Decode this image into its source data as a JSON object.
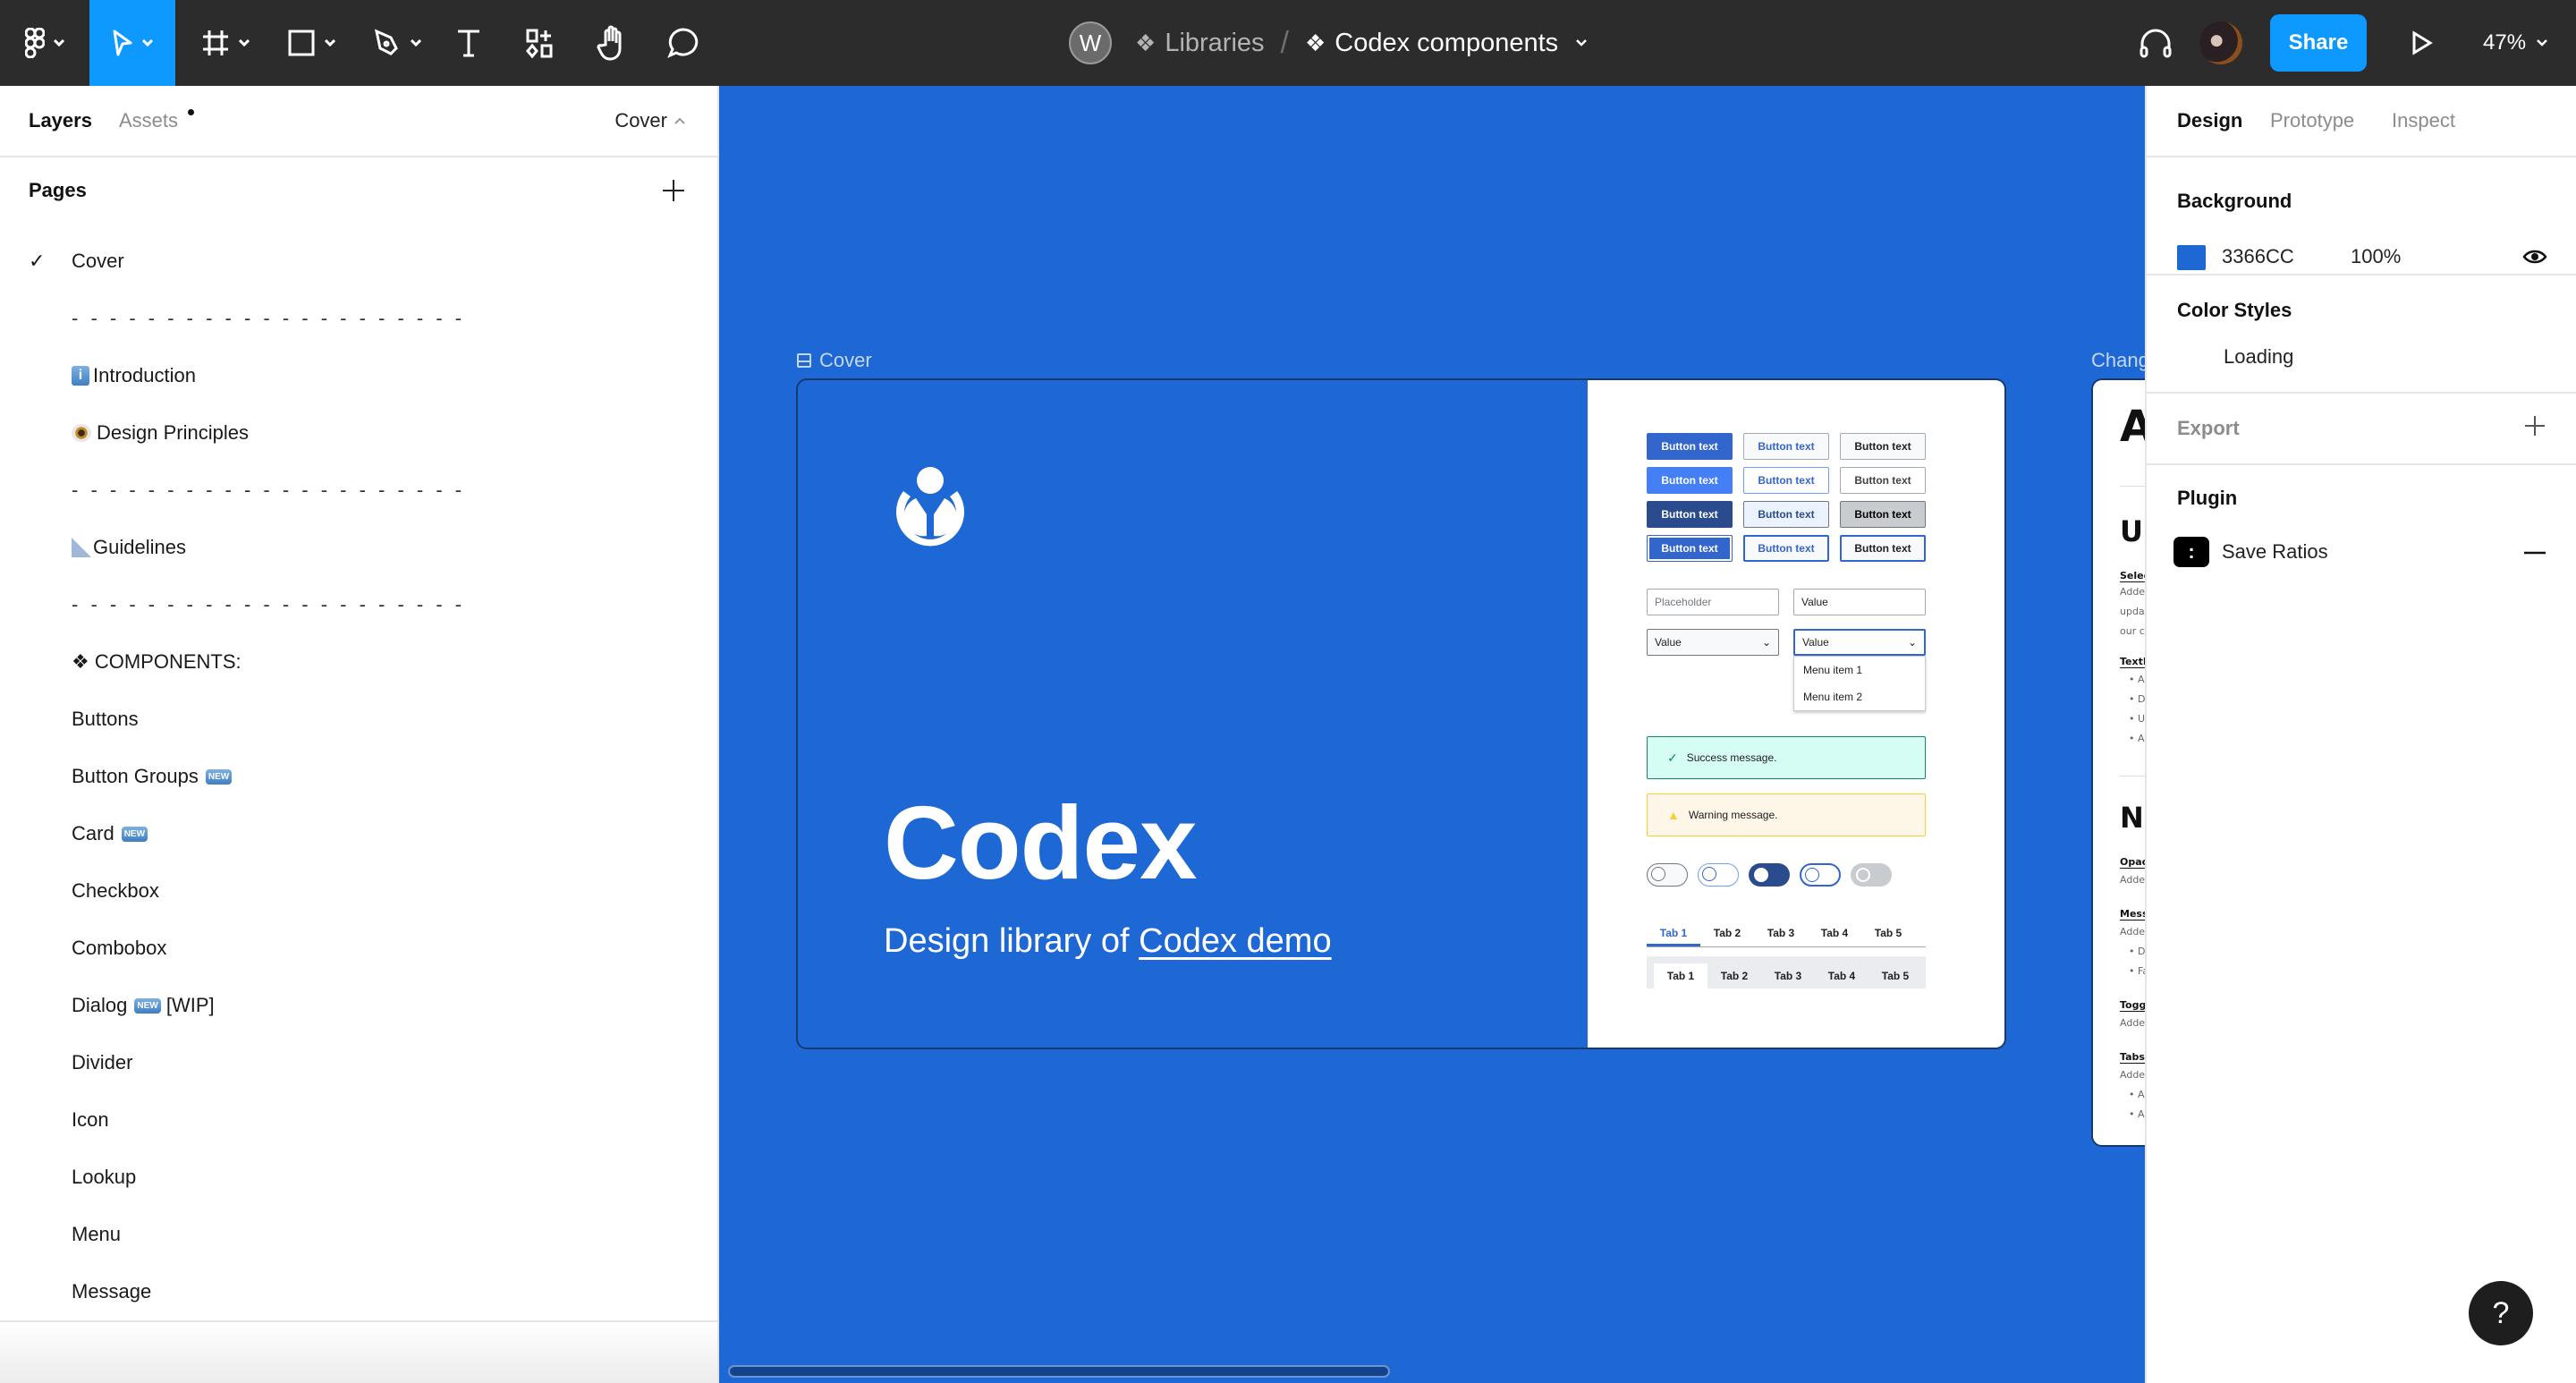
{
  "toolbar": {
    "tools": [
      "main-menu",
      "move",
      "frame",
      "shape",
      "pen",
      "text",
      "resources",
      "hand",
      "comment"
    ],
    "active_tool": "move"
  },
  "breadcrumb": {
    "team_initial": "W",
    "project": "Libraries",
    "file": "Codex components"
  },
  "header_right": {
    "share_label": "Share",
    "zoom_level": "47%"
  },
  "left_panel": {
    "tab_layers": "Layers",
    "tab_assets": "Assets",
    "current_page": "Cover",
    "pages_title": "Pages",
    "pages": [
      {
        "label": "Cover",
        "selected": true
      },
      {
        "label": "- - - - - - - - - - - - - - - - - - - - -"
      },
      {
        "label": "Introduction",
        "emoji": "info"
      },
      {
        "label": "Design Principles",
        "emoji": "eye"
      },
      {
        "label": "- - - - - - - - - - - - - - - - - - - - -"
      },
      {
        "label": "Guidelines",
        "emoji": "ruler"
      },
      {
        "label": "- - - - - - - - - - - - - - - - - - - - -"
      },
      {
        "label": "❖ COMPONENTS:"
      },
      {
        "label": "Buttons"
      },
      {
        "label": "Button Groups",
        "badge": "NEW"
      },
      {
        "label": "Card",
        "badge": "NEW"
      },
      {
        "label": "Checkbox"
      },
      {
        "label": "Combobox"
      },
      {
        "label": "Dialog",
        "badge": "NEW",
        "suffix": "[WIP]"
      },
      {
        "label": "Divider"
      },
      {
        "label": "Icon"
      },
      {
        "label": "Lookup"
      },
      {
        "label": "Menu"
      },
      {
        "label": "Message"
      }
    ],
    "badge_text": "NEW"
  },
  "canvas": {
    "background_color": "#1d68d4",
    "cover_frame": {
      "label": "Cover",
      "title": "Codex",
      "subtitle_prefix": "Design library of ",
      "subtitle_link": "Codex demo",
      "buttons": [
        "Button text",
        "Button text",
        "Button text",
        "Button text",
        "Button text",
        "Button text",
        "Button text",
        "Button text",
        "Button text",
        "Button text",
        "Button text",
        "Button text"
      ],
      "input_placeholder": "Placeholder",
      "input_value": "Value",
      "select_value_1": "Value",
      "select_value_2": "Value",
      "menu_items": [
        "Menu item 1",
        "Menu item 2"
      ],
      "success_message": "Success message.",
      "warning_message": "Warning message.",
      "toggles": [
        "off",
        "off-hover",
        "on",
        "off-focus",
        "disabled"
      ],
      "tabs_quiet": [
        "Tab 1",
        "Tab 2",
        "Tab 3",
        "Tab 4",
        "Tab 5"
      ],
      "tabs_framed": [
        "Tab 1",
        "Tab 2",
        "Tab 3",
        "Tab 4",
        "Tab 5"
      ]
    },
    "changelog_frame": {
      "label": "Chang",
      "h1": "A",
      "h2_a": "Up",
      "h3_a": "Selec",
      "p_a": [
        "Adde",
        "updat",
        "our c"
      ],
      "h3_b": "TextI",
      "li_b": [
        "Ad",
        "De",
        "Up",
        "Ad"
      ],
      "h2_b": "Ne",
      "h3_c": "Opac",
      "p_c": "Adde",
      "h3_d": "Mess",
      "p_d": "Adde",
      "li_d": [
        "Di",
        "Fa"
      ],
      "h3_e": "Toggl",
      "p_e": "Adde",
      "h3_f": "Tabs",
      "p_f": "Adde",
      "li_f": [
        "Ad",
        "Ad"
      ]
    }
  },
  "right_panel": {
    "tabs": [
      "Design",
      "Prototype",
      "Inspect"
    ],
    "active_tab": "Design",
    "background_title": "Background",
    "background_hex": "3366CC",
    "background_opacity": "100%",
    "color_styles_title": "Color Styles",
    "color_styles_status": "Loading",
    "export_title": "Export",
    "plugin_title": "Plugin",
    "plugin_name": "Save Ratios"
  },
  "help_label": "?"
}
